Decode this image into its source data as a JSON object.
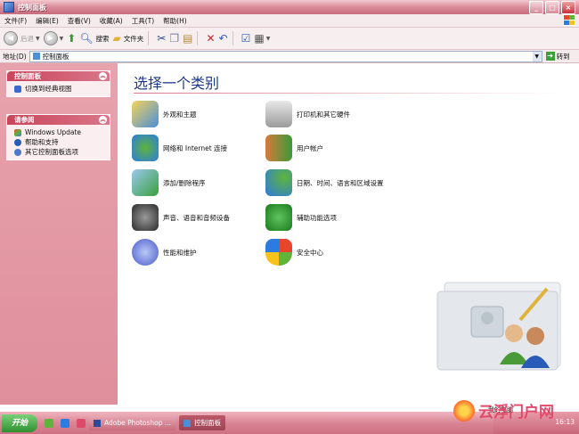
{
  "window": {
    "title": "控制面板"
  },
  "menu": [
    "文件(F)",
    "编辑(E)",
    "查看(V)",
    "收藏(A)",
    "工具(T)",
    "帮助(H)"
  ],
  "toolbar": {
    "back": "后退",
    "search": "搜索",
    "folders": "文件夹"
  },
  "address": {
    "label": "地址(D)",
    "value": "控制面板",
    "go": "转到"
  },
  "left_panels": {
    "control_panel": {
      "title": "控制面板",
      "items": [
        "切换到经典视图"
      ]
    },
    "see_also": {
      "title": "请参阅",
      "items": [
        "Windows Update",
        "帮助和支持",
        "其它控制面板选项"
      ]
    }
  },
  "main": {
    "heading": "选择一个类别",
    "categories": [
      "外观和主题",
      "打印机和其它硬件",
      "网络和 Internet 连接",
      "用户帐户",
      "添加/删除程序",
      "日期、时间、语言和区域设置",
      "声音、语音和音频设备",
      "辅助功能选项",
      "性能和维护",
      "安全中心"
    ]
  },
  "taskbar": {
    "start": "开始",
    "tasks": [
      "Adobe Photoshop ...",
      "控制面板"
    ],
    "clock": "16:13"
  },
  "watermark": {
    "text": "云浮门户网",
    "label": "我的电脑"
  },
  "colors": {
    "title_bar": "#d98a98",
    "panel_header": "#c9445b",
    "heading_text": "#1d3a8a"
  }
}
